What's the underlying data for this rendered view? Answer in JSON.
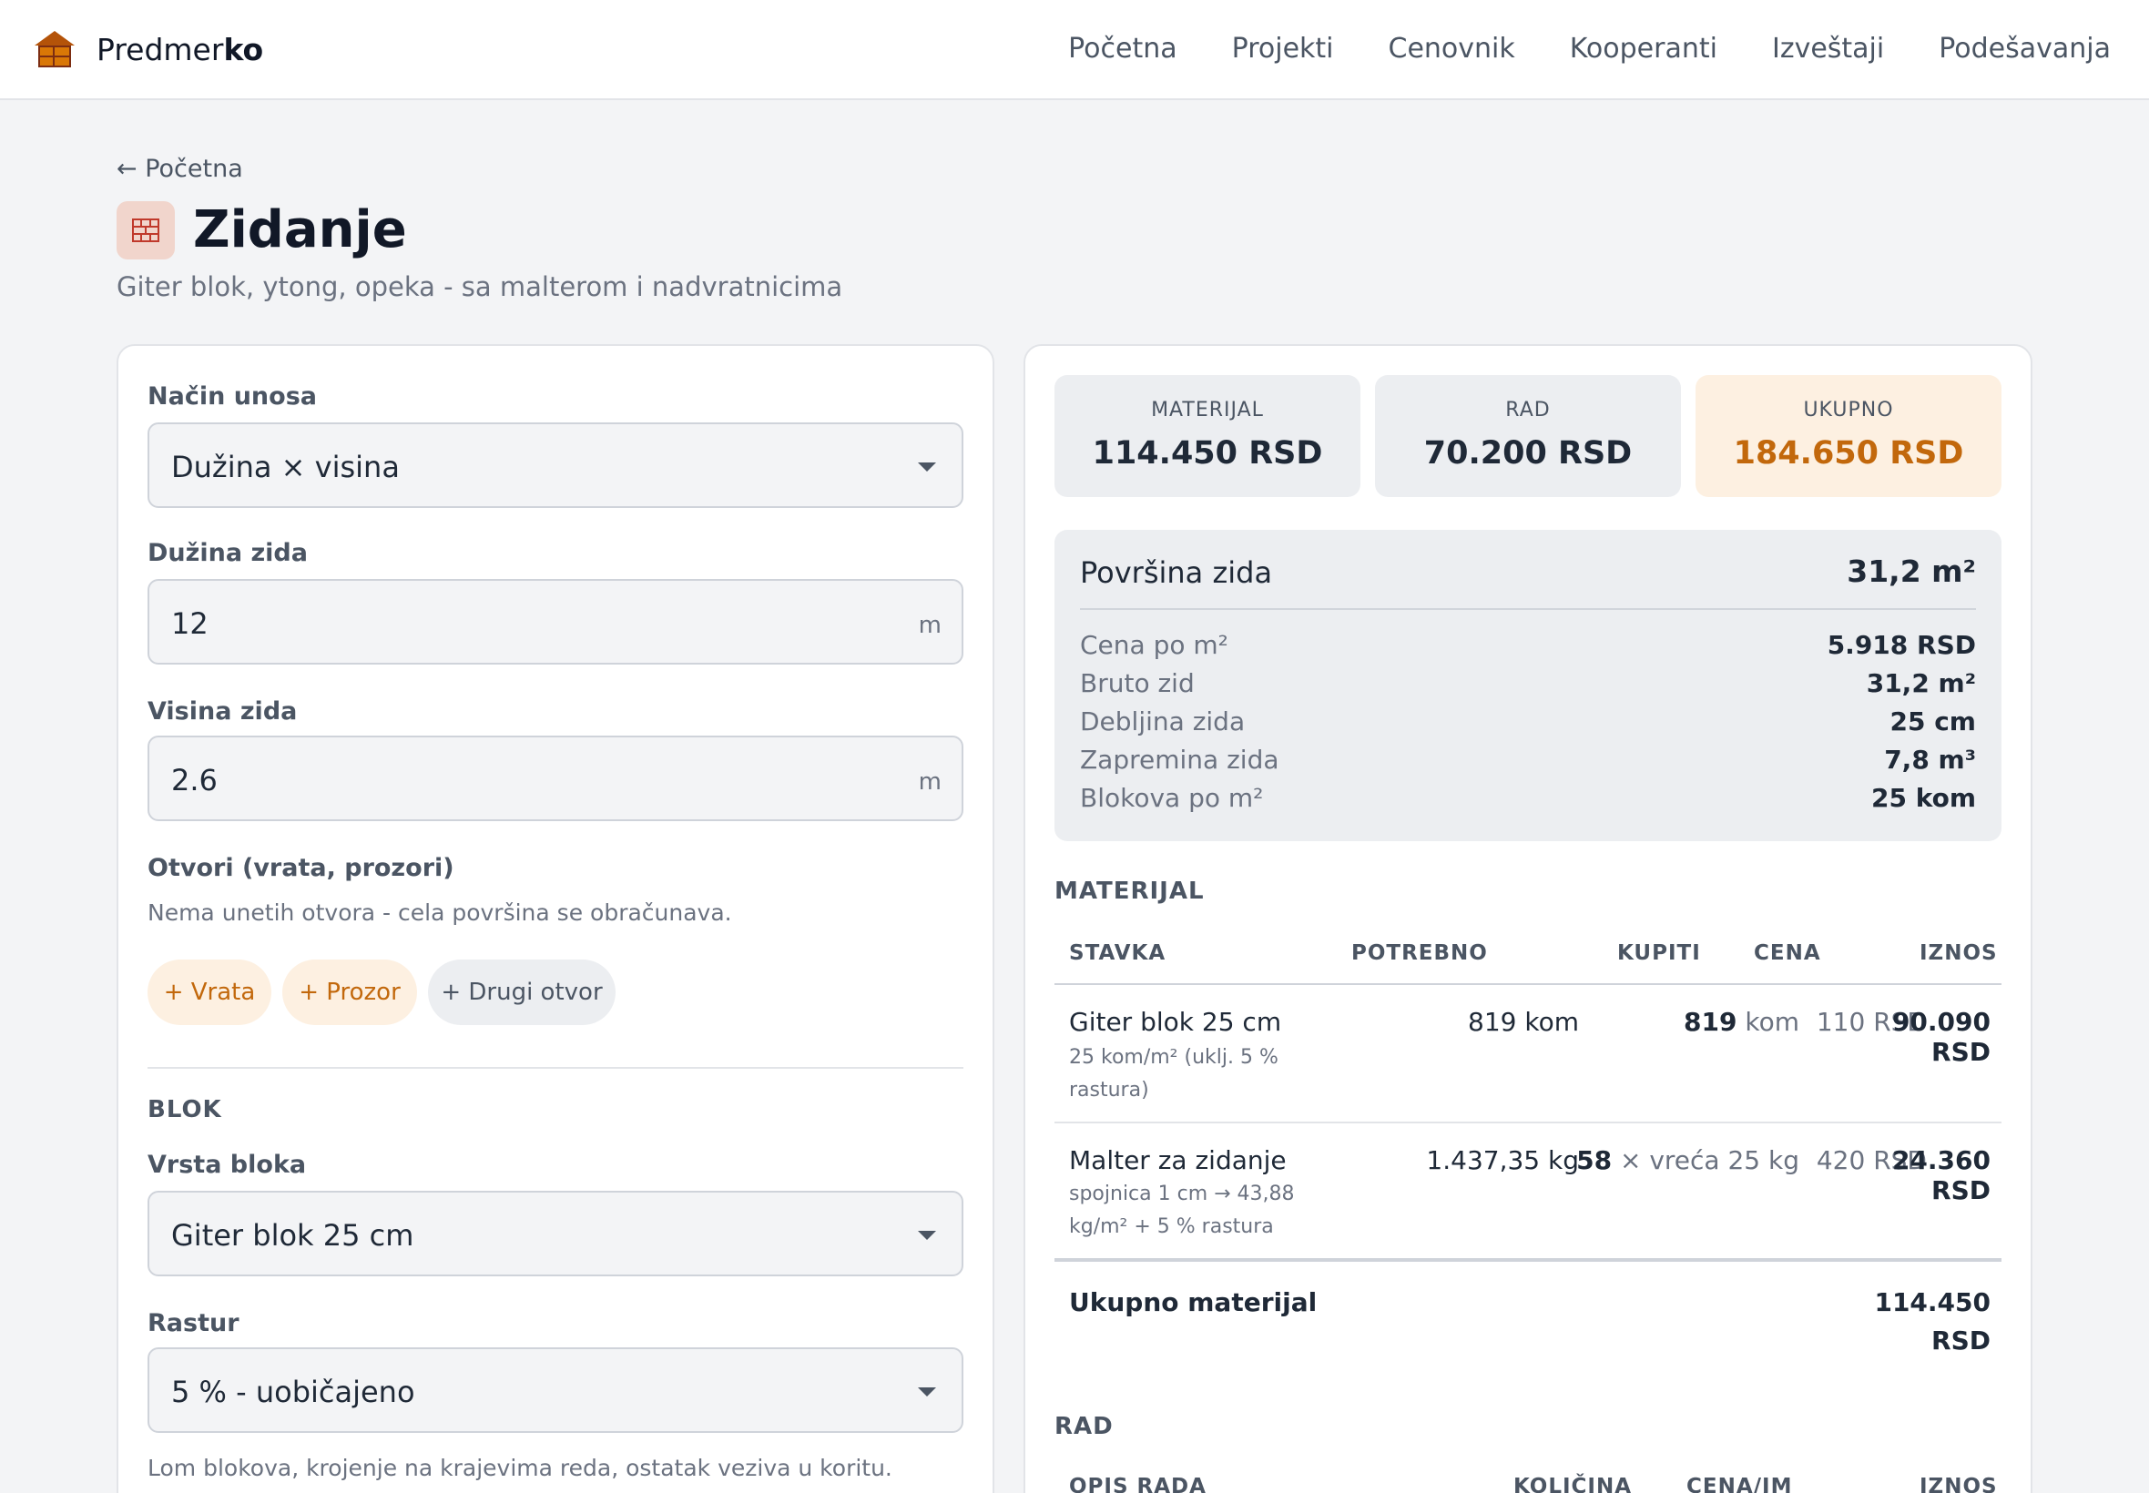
{
  "app": {
    "brand_plain": "Predmer",
    "brand_bold": "ko",
    "accent_color": "#c2680c"
  },
  "nav": {
    "items": [
      {
        "label": "Početna"
      },
      {
        "label": "Projekti"
      },
      {
        "label": "Cenovnik"
      },
      {
        "label": "Kooperanti"
      },
      {
        "label": "Izveštaji"
      },
      {
        "label": "Podešavanja"
      }
    ]
  },
  "header": {
    "back_link": "← Početna",
    "title": "Zidanje",
    "subtitle": "Giter blok, ytong, opeka - sa malterom i nadvratnicima",
    "icon": "brick-icon"
  },
  "form": {
    "input_mode": {
      "label": "Način unosa",
      "value": "Dužina × visina"
    },
    "wall_length": {
      "label": "Dužina zida",
      "value": "12",
      "unit": "m"
    },
    "wall_height": {
      "label": "Visina zida",
      "value": "2.6",
      "unit": "m"
    },
    "openings": {
      "label": "Otvori (vrata, prozori)",
      "empty_note": "Nema unetih otvora - cela površina se obračunava.",
      "add_door": "+ Vrata",
      "add_window": "+ Prozor",
      "add_other": "+ Drugi otvor"
    },
    "block_section": "BLOK",
    "block_type": {
      "label": "Vrsta bloka",
      "value": "Giter blok 25 cm"
    },
    "waste": {
      "label": "Rastur",
      "value": "5 % - uobičajeno",
      "note": "Lom blokova, krojenje na krajevima reda, ostatak veziva u koritu."
    }
  },
  "stats": {
    "material": {
      "label": "MATERIJAL",
      "value": "114.450 RSD"
    },
    "labor": {
      "label": "RAD",
      "value": "70.200 RSD"
    },
    "total": {
      "label": "UKUPNO",
      "value": "184.650 RSD"
    }
  },
  "summary": {
    "main_label": "Površina zida",
    "main_value": "31,2 m²",
    "rows": [
      {
        "key": "Cena po m²",
        "value": "5.918 RSD"
      },
      {
        "key": "Bruto zid",
        "value": "31,2 m²"
      },
      {
        "key": "Debljina zida",
        "value": "25 cm"
      },
      {
        "key": "Zapremina zida",
        "value": "7,8 m³"
      },
      {
        "key": "Blokova po m²",
        "value": "25 kom"
      }
    ]
  },
  "material_table": {
    "section_title": "MATERIJAL",
    "columns": {
      "item": "STAVKA",
      "needed": "POTREBNO",
      "buy": "KUPITI",
      "price": "CENA",
      "amount": "IZNOS"
    },
    "rows": [
      {
        "name": "Giter blok 25 cm",
        "note": "25 kom/m² (uklj. 5 % rastura)",
        "needed": "819 kom",
        "buy_qty": "819",
        "buy_unit": "kom",
        "price": "110 RSD",
        "amount": "90.090 RSD"
      },
      {
        "name": "Malter za zidanje",
        "note": "spojnica 1 cm → 43,88 kg/m² + 5 % rastura",
        "needed": "1.437,35 kg",
        "buy_qty": "58",
        "buy_unit": "× vreća 25 kg",
        "price": "420 RSD",
        "amount": "24.360 RSD"
      }
    ],
    "total_label": "Ukupno materijal",
    "total_value_line1": "114.450",
    "total_value_line2": "RSD"
  },
  "labor_table": {
    "section_title": "RAD",
    "columns": {
      "work": "OPIS RADA",
      "qty": "KOLIČINA",
      "unit_price": "CENA/JM",
      "amount": "IZNOS"
    }
  }
}
